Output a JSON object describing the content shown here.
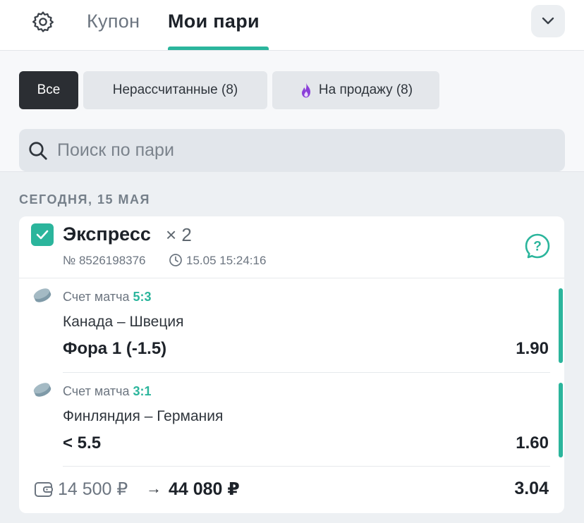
{
  "header": {
    "tabs": [
      {
        "label": "Купон",
        "active": false
      },
      {
        "label": "Мои пари",
        "active": true
      }
    ],
    "icons": {
      "settings": "gear-icon",
      "collapse": "chevron-down-icon"
    }
  },
  "filters": {
    "chips": [
      {
        "label": "Все",
        "active": true
      },
      {
        "label": "Нерассчитанные (8)",
        "active": false
      },
      {
        "label": "На продажу (8)",
        "active": false,
        "icon": "fire-icon"
      }
    ]
  },
  "search": {
    "placeholder": "Поиск по пари",
    "value": ""
  },
  "date_header": "СЕГОДНЯ, 15 МАЯ",
  "bet": {
    "type": "Экспресс",
    "multiplier": "× 2",
    "number": "№ 8526198376",
    "datetime": "15.05 15:24:16",
    "selections": [
      {
        "label": "Счет матча",
        "score": "5:3",
        "teams": "Канада – Швеция",
        "outcome": "Фора 1 (-1.5)",
        "odds": "1.90"
      },
      {
        "label": "Счет матча",
        "score": "3:1",
        "teams": "Финляндия – Германия",
        "outcome": "< 5.5",
        "odds": "1.60"
      }
    ],
    "stake": "14 500 ₽",
    "arrow": "→",
    "payout": "44 080 ₽",
    "total_odds": "3.04"
  },
  "colors": {
    "accent": "#2bb59c",
    "dark_chip": "#2b2e33",
    "fire": "#8b3fd9",
    "background": "#edf0f3"
  }
}
